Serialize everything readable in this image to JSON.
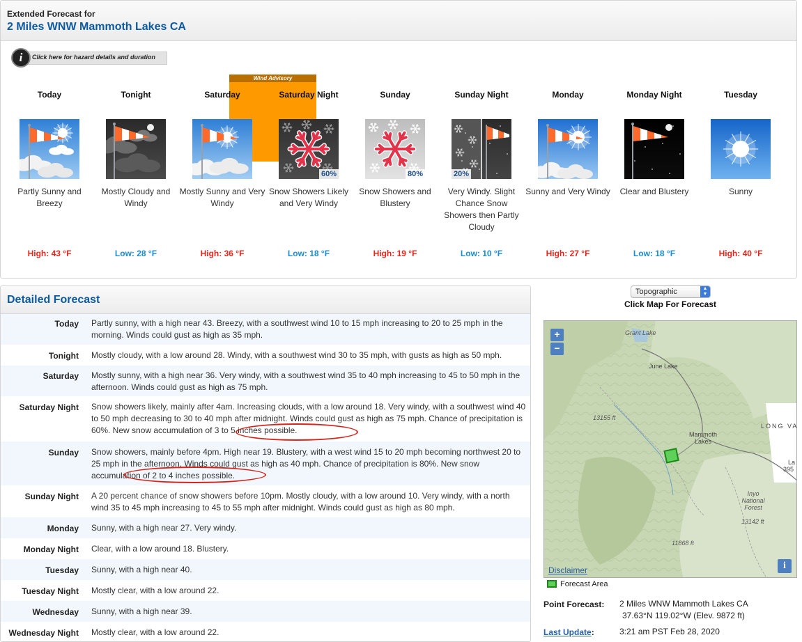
{
  "header": {
    "label": "Extended Forecast for",
    "location": "2 Miles WNW Mammoth Lakes CA"
  },
  "hazard": {
    "link_text": "Click here for hazard details and duration",
    "icon": "info-icon"
  },
  "advisory": {
    "label": "Wind Advisory",
    "color": "#ff9900"
  },
  "periods": [
    {
      "name": "Today",
      "desc": "Partly Sunny and Breezy",
      "temp": "High: 43 °F",
      "kind": "high",
      "icon": "windsock-partly-sunny",
      "pop": ""
    },
    {
      "name": "Tonight",
      "desc": "Mostly Cloudy and Windy",
      "temp": "Low: 28 °F",
      "kind": "low",
      "icon": "windsock-cloudy-night",
      "pop": ""
    },
    {
      "name": "Saturday",
      "desc": "Mostly Sunny and Very Windy",
      "temp": "High: 36 °F",
      "kind": "high",
      "icon": "windsock-mostly-sunny",
      "pop": ""
    },
    {
      "name": "Saturday Night",
      "desc": "Snow Showers Likely and Very Windy",
      "temp": "Low: 18 °F",
      "kind": "low",
      "icon": "snowflake-night",
      "pop": "60%"
    },
    {
      "name": "Sunday",
      "desc": "Snow Showers and Blustery",
      "temp": "High: 19 °F",
      "kind": "high",
      "icon": "snowflake-day",
      "pop": "80%"
    },
    {
      "name": "Sunday Night",
      "desc": "Very Windy. Slight Chance Snow Showers then Partly Cloudy",
      "temp": "Low: 10 °F",
      "kind": "low",
      "icon": "snow-then-windsock-night",
      "pop": "20%"
    },
    {
      "name": "Monday",
      "desc": "Sunny and Very Windy",
      "temp": "High: 27 °F",
      "kind": "high",
      "icon": "windsock-sunny",
      "pop": ""
    },
    {
      "name": "Monday Night",
      "desc": "Clear and Blustery",
      "temp": "Low: 18 °F",
      "kind": "low",
      "icon": "windsock-clear-night",
      "pop": ""
    },
    {
      "name": "Tuesday",
      "desc": "Sunny",
      "temp": "High: 40 °F",
      "kind": "high",
      "icon": "sun-icon",
      "pop": ""
    }
  ],
  "detailed": {
    "title": "Detailed Forecast",
    "rows": [
      {
        "label": "Today",
        "text": "Partly sunny, with a high near 43. Breezy, with a southwest wind 10 to 15 mph increasing to 20 to 25 mph in the morning. Winds could gust as high as 35 mph."
      },
      {
        "label": "Tonight",
        "text": "Mostly cloudy, with a low around 28. Windy, with a southwest wind 30 to 35 mph, with gusts as high as 50 mph."
      },
      {
        "label": "Saturday",
        "text": "Mostly sunny, with a high near 36. Very windy, with a southwest wind 35 to 40 mph increasing to 45 to 50 mph in the afternoon. Winds could gust as high as 75 mph."
      },
      {
        "label": "Saturday Night",
        "text": "Snow showers likely, mainly after 4am. Increasing clouds, with a low around 18. Very windy, with a southwest wind 40 to 50 mph decreasing to 30 to 40 mph after midnight. Winds could gust as high as 75 mph. Chance of precipitation is 60%. New snow accumulation of 3 to 5 inches possible."
      },
      {
        "label": "Sunday",
        "text": "Snow showers, mainly before 4pm. High near 19. Blustery, with a west wind 15 to 20 mph becoming northwest 20 to 25 mph in the afternoon. Winds could gust as high as 40 mph. Chance of precipitation is 80%. New snow accumulation of 2 to 4 inches possible."
      },
      {
        "label": "Sunday Night",
        "text": "A 20 percent chance of snow showers before 10pm. Mostly cloudy, with a low around 10. Very windy, with a north wind 35 to 45 mph increasing to 45 to 55 mph after midnight. Winds could gust as high as 80 mph."
      },
      {
        "label": "Monday",
        "text": "Sunny, with a high near 27. Very windy."
      },
      {
        "label": "Monday Night",
        "text": "Clear, with a low around 18. Blustery."
      },
      {
        "label": "Tuesday",
        "text": "Sunny, with a high near 40."
      },
      {
        "label": "Tuesday Night",
        "text": "Mostly clear, with a low around 22."
      },
      {
        "label": "Wednesday",
        "text": "Sunny, with a high near 39."
      },
      {
        "label": "Wednesday Night",
        "text": "Mostly clear, with a low around 22."
      }
    ]
  },
  "map": {
    "select_value": "Topographic",
    "instruction": "Click Map For Forecast",
    "zoom_in": "+",
    "zoom_out": "−",
    "disclaimer": "Disclaimer",
    "info_button": "i",
    "labels": {
      "grant_lake": "Grant Lake",
      "june_lake": "June Lake",
      "mammoth_lakes": "Mammoth Lakes",
      "elev_13155": "13155 ft",
      "long_valley": "LONG VA",
      "inyo_forest": "Inyo National Forest",
      "elev_13142": "13142 ft",
      "elev_11868": "11868 ft",
      "route_395": "395",
      "la": "La"
    },
    "legend_label": "Forecast Area",
    "forecast_area_color": "#5fd15b"
  },
  "point": {
    "label": "Point Forecast:",
    "location": "2 Miles WNW Mammoth Lakes CA",
    "coords": "37.63°N 119.02°W (Elev. 9872 ft)",
    "update_label": "Last Update",
    "update_colon": ":",
    "update_value": "3:21 am PST Feb 28, 2020"
  },
  "colors": {
    "high": "#e4251c",
    "low": "#1b8bd2",
    "title_blue": "#0c5ba1",
    "highlight_oval": "#d2261d"
  }
}
